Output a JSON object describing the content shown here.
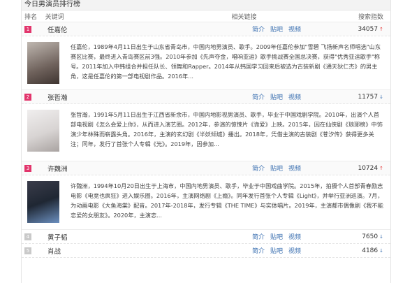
{
  "board": {
    "title": "今日男演员排行榜",
    "columns": {
      "rank": "排名",
      "keyword": "关键词",
      "links": "相关链接",
      "index": "搜索指数"
    }
  },
  "rows": [
    {
      "rank": "1",
      "keyword": "任嘉伦",
      "links": [
        "简介",
        "贴吧",
        "视频"
      ],
      "index": "34057",
      "trend": "↑",
      "detail": "任嘉伦，1989年4月11日出生于山东省青岛市，中国内地男演员、歌手。2009年任嘉伦参加\"雪碧 飞扬新声名师唱选\"山东赛区比赛，最终进入青岛赛区前3强。2010年参加《先声夺金，唱响亚运》歌手挑战赛全国总决赛，获得\"优秀亚运歌手\"称号。2011年加入中韩组合并担任队长、领舞和Rapper。2014年从韩国学习回来后被选为古装新剧《通天狄仁杰》的男主角，这是任嘉伦的第一部电视剧作品。2016年..."
    },
    {
      "rank": "2",
      "keyword": "张哲瀚",
      "links": [
        "简介",
        "贴吧",
        "视频"
      ],
      "index": "11757",
      "trend": "↓",
      "detail": "张哲瀚，1991年5月11日出生于江西省新余市，中国内地影视男演员、歌手，毕业于中国戏剧学院。2010年，出演个人首部电视剧《怎么会爱上你》，从而进入演艺圈。2012年，参演的惊悚片《诡爱》上映。2015年，因在仙侠剧《琅琊榜》中饰演少年林殊而崭露头角。2016年，主演的玄幻剧《半妖倾城》播出。2018年，凭借主演的古装剧《苍汐传》获得更多关注；同年，发行了首张个人专辑《光》。2019年，因参加..."
    },
    {
      "rank": "3",
      "keyword": "许魏洲",
      "links": [
        "简介",
        "贴吧",
        "视频"
      ],
      "index": "10724",
      "trend": "↑",
      "detail": "许魏洲，1994年10月20日出生于上海市，中国内地男演员、歌手，毕业于中国戏曲学院。2015年，拍摄个人首部青春励志电影《电竞也疯狂》进入娱乐圈。2016年，主演网络剧《上瘾》。同年发行首张个人专辑《Light》，并举行亚洲巡演。7月，为动画电影《大鱼海棠》配音。2017年-2018年，发行专辑《THE TIME》与实体唱片。2019年，主演都市偶像剧《我不能恋爱的女朋友》。2020年，主演恋..."
    },
    {
      "rank": "4",
      "keyword": "黄子韬",
      "links": [
        "简介",
        "贴吧",
        "视频"
      ],
      "index": "7650",
      "trend": "↓"
    },
    {
      "rank": "5",
      "keyword": "肖战",
      "links": [
        "简介",
        "贴吧",
        "视频"
      ],
      "index": "4186",
      "trend": "↓"
    }
  ]
}
